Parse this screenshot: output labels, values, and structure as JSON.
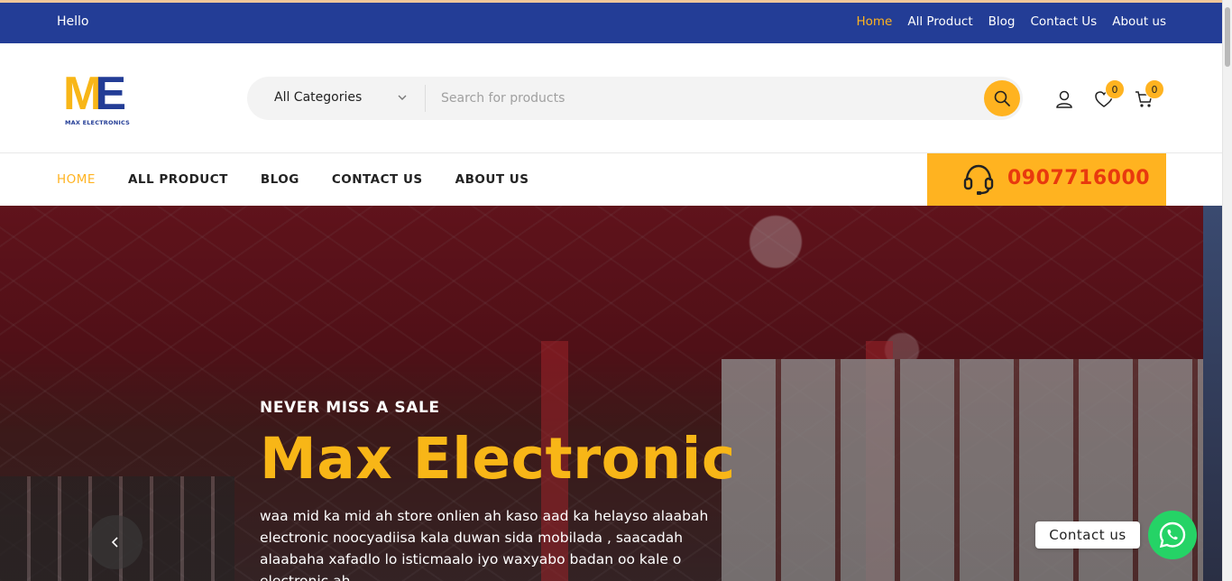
{
  "topbar": {
    "greeting": "Hello",
    "links": [
      "Home",
      "All Product",
      "Blog",
      "Contact Us",
      "About us"
    ]
  },
  "header": {
    "logo_text": "MAX ELECTRONICS",
    "category_select": "All Categories",
    "search_placeholder": "Search for products",
    "wishlist_count": "0",
    "cart_count": "0"
  },
  "nav": {
    "links": [
      "HOME",
      "ALL PRODUCT",
      "BLOG",
      "CONTACT US",
      "ABOUT US"
    ],
    "phone": "0907716000"
  },
  "hero": {
    "kicker": "NEVER MISS A SALE",
    "title": "Max Electronic",
    "description": "waa mid ka mid ah store onlien ah kaso aad ka helayso alaabah electronic noocyadiisa kala duwan sida mobilada , saacadah alaabaha xafadlo lo isticmaalo iyo waxyabo badan oo kale o electronic ah"
  },
  "contact_widget": {
    "label": "Contact us"
  },
  "colors": {
    "brand_blue": "#233d96",
    "accent_yellow": "#ffb320",
    "phone_red": "#e8390e",
    "whatsapp_green": "#25d366"
  },
  "icons": [
    "chevron-down-icon",
    "search-icon",
    "user-icon",
    "heart-icon",
    "cart-icon",
    "headset-icon",
    "chevron-left-icon",
    "whatsapp-icon"
  ]
}
